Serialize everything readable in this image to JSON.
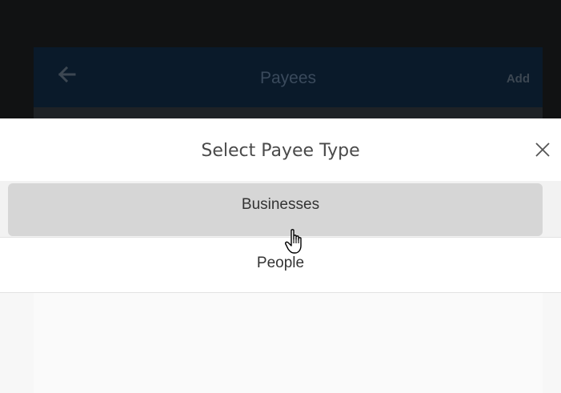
{
  "background_app": {
    "title": "Payees",
    "back_icon": "arrow-left-icon",
    "add_label": "Add",
    "header_color": "#0a1a2a"
  },
  "sheet": {
    "title": "Select Payee Type",
    "close_icon": "close-icon",
    "options": [
      {
        "label": "Businesses",
        "state": "hovered"
      },
      {
        "label": "People",
        "state": "default"
      }
    ]
  },
  "colors": {
    "backdrop": "#111213",
    "hover_pill": "#d6d6d6",
    "body_bg": "#f2f2f2"
  }
}
